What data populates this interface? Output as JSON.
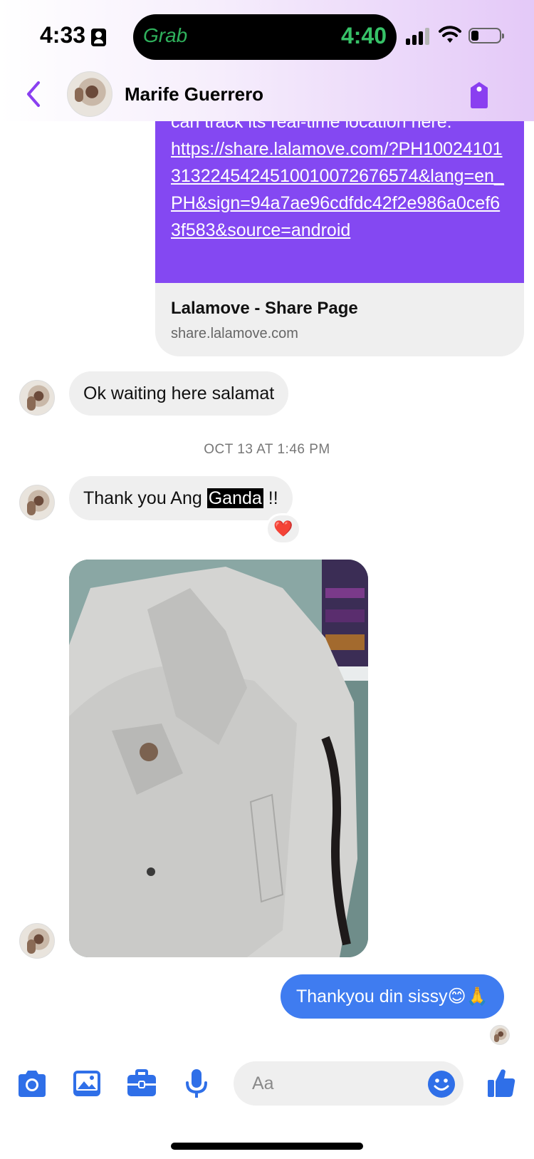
{
  "status_bar": {
    "time": "4:33",
    "island_app": "Grab",
    "island_time": "4:40"
  },
  "header": {
    "contact_name": "Marife Guerrero"
  },
  "messages": {
    "link_intro": "can track its real-time location here:",
    "link_url": "https://share.lalamove.com/?PH100241013132245424510010072676574&lang=en_PH&sign=94a7ae96cdfdc42f2e986a0cef63f583&source=android",
    "link_title": "Lalamove - Share Page",
    "link_domain": "share.lalamove.com",
    "msg1": "Ok waiting here salamat",
    "timestamp": "OCT 13 AT 1:46 PM",
    "msg2_before": "Thank you Ang ",
    "msg2_highlight": "Ganda",
    "msg2_after": " !!",
    "reaction": "❤️",
    "outgoing": "Thankyou din sissy😊🙏"
  },
  "composer": {
    "placeholder": "Aa"
  },
  "colors": {
    "accent_purple": "#8448f2",
    "outgoing_blue": "#3f7cf0",
    "icon_blue": "#2f6fe8",
    "bubble_gray": "#efefef"
  }
}
